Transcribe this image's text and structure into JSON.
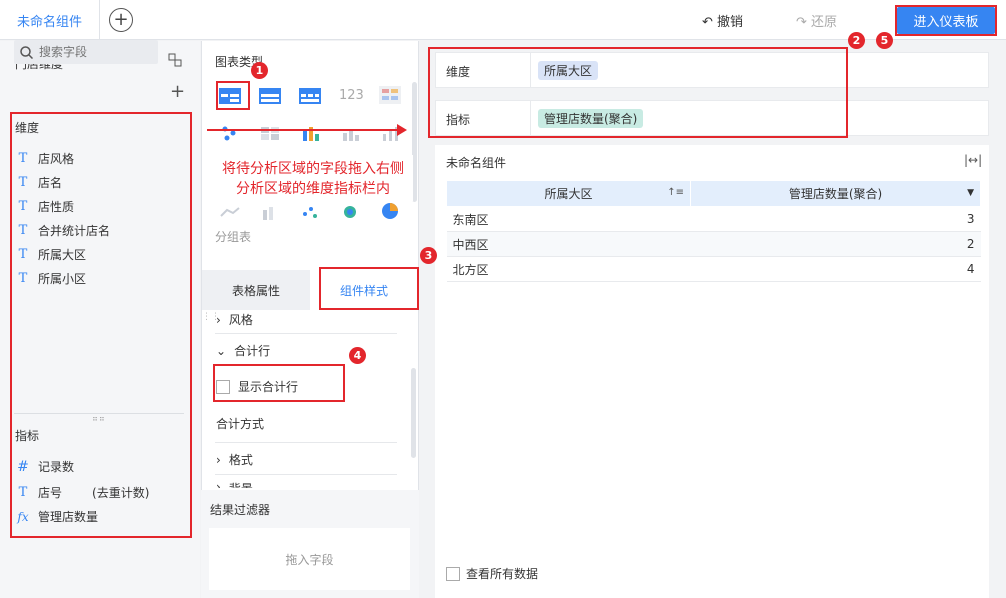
{
  "topbar": {
    "tab_title": "未命名组件",
    "add_symbol": "+",
    "undo": "撤销",
    "redo": "还原",
    "enter_dashboard": "进入仪表板"
  },
  "left": {
    "title": "门店维度",
    "search_placeholder": "搜索字段",
    "dimension_label": "维度",
    "dimensions": [
      "店风格",
      "店名",
      "店性质",
      "合并统计店名",
      "所属大区",
      "所属小区"
    ],
    "measure_label": "指标",
    "measures": [
      {
        "icon": "#",
        "name": "记录数",
        "note": ""
      },
      {
        "icon": "T",
        "name": "店号",
        "note": "(去重计数)"
      },
      {
        "icon": "fx",
        "name": "管理店数量",
        "note": ""
      }
    ]
  },
  "middle": {
    "chart_type_label": "图表类型",
    "group_table_label": "分组表",
    "tab_table_props": "表格属性",
    "tab_component_style": "组件样式",
    "sections": {
      "style": "风格",
      "total_row": "合计行",
      "show_total_row": "显示合计行",
      "total_method": "合计方式",
      "format": "格式",
      "background": "背景"
    },
    "result_filter": "结果过滤器",
    "drop_field": "拖入字段"
  },
  "right": {
    "dimension_label": "维度",
    "dimension_pill": "所属大区",
    "measure_label": "指标",
    "measure_pill": "管理店数量(聚合)",
    "widget_title": "未命名组件",
    "table": {
      "headers": [
        "所属大区",
        "管理店数量(聚合)"
      ],
      "rows": [
        [
          "东南区",
          "3"
        ],
        [
          "中西区",
          "2"
        ],
        [
          "北方区",
          "4"
        ]
      ]
    },
    "view_all": "查看所有数据"
  },
  "annotations": {
    "note": "将待分析区域的字段拖入右侧分析区域的维度指标栏内",
    "markers": [
      "1",
      "2",
      "3",
      "4",
      "5"
    ],
    "color": "#e3262c"
  },
  "colors": {
    "accent": "#3685f2",
    "dimension_pill": "#d9e3f7",
    "measure_pill": "#c8ebe3"
  }
}
